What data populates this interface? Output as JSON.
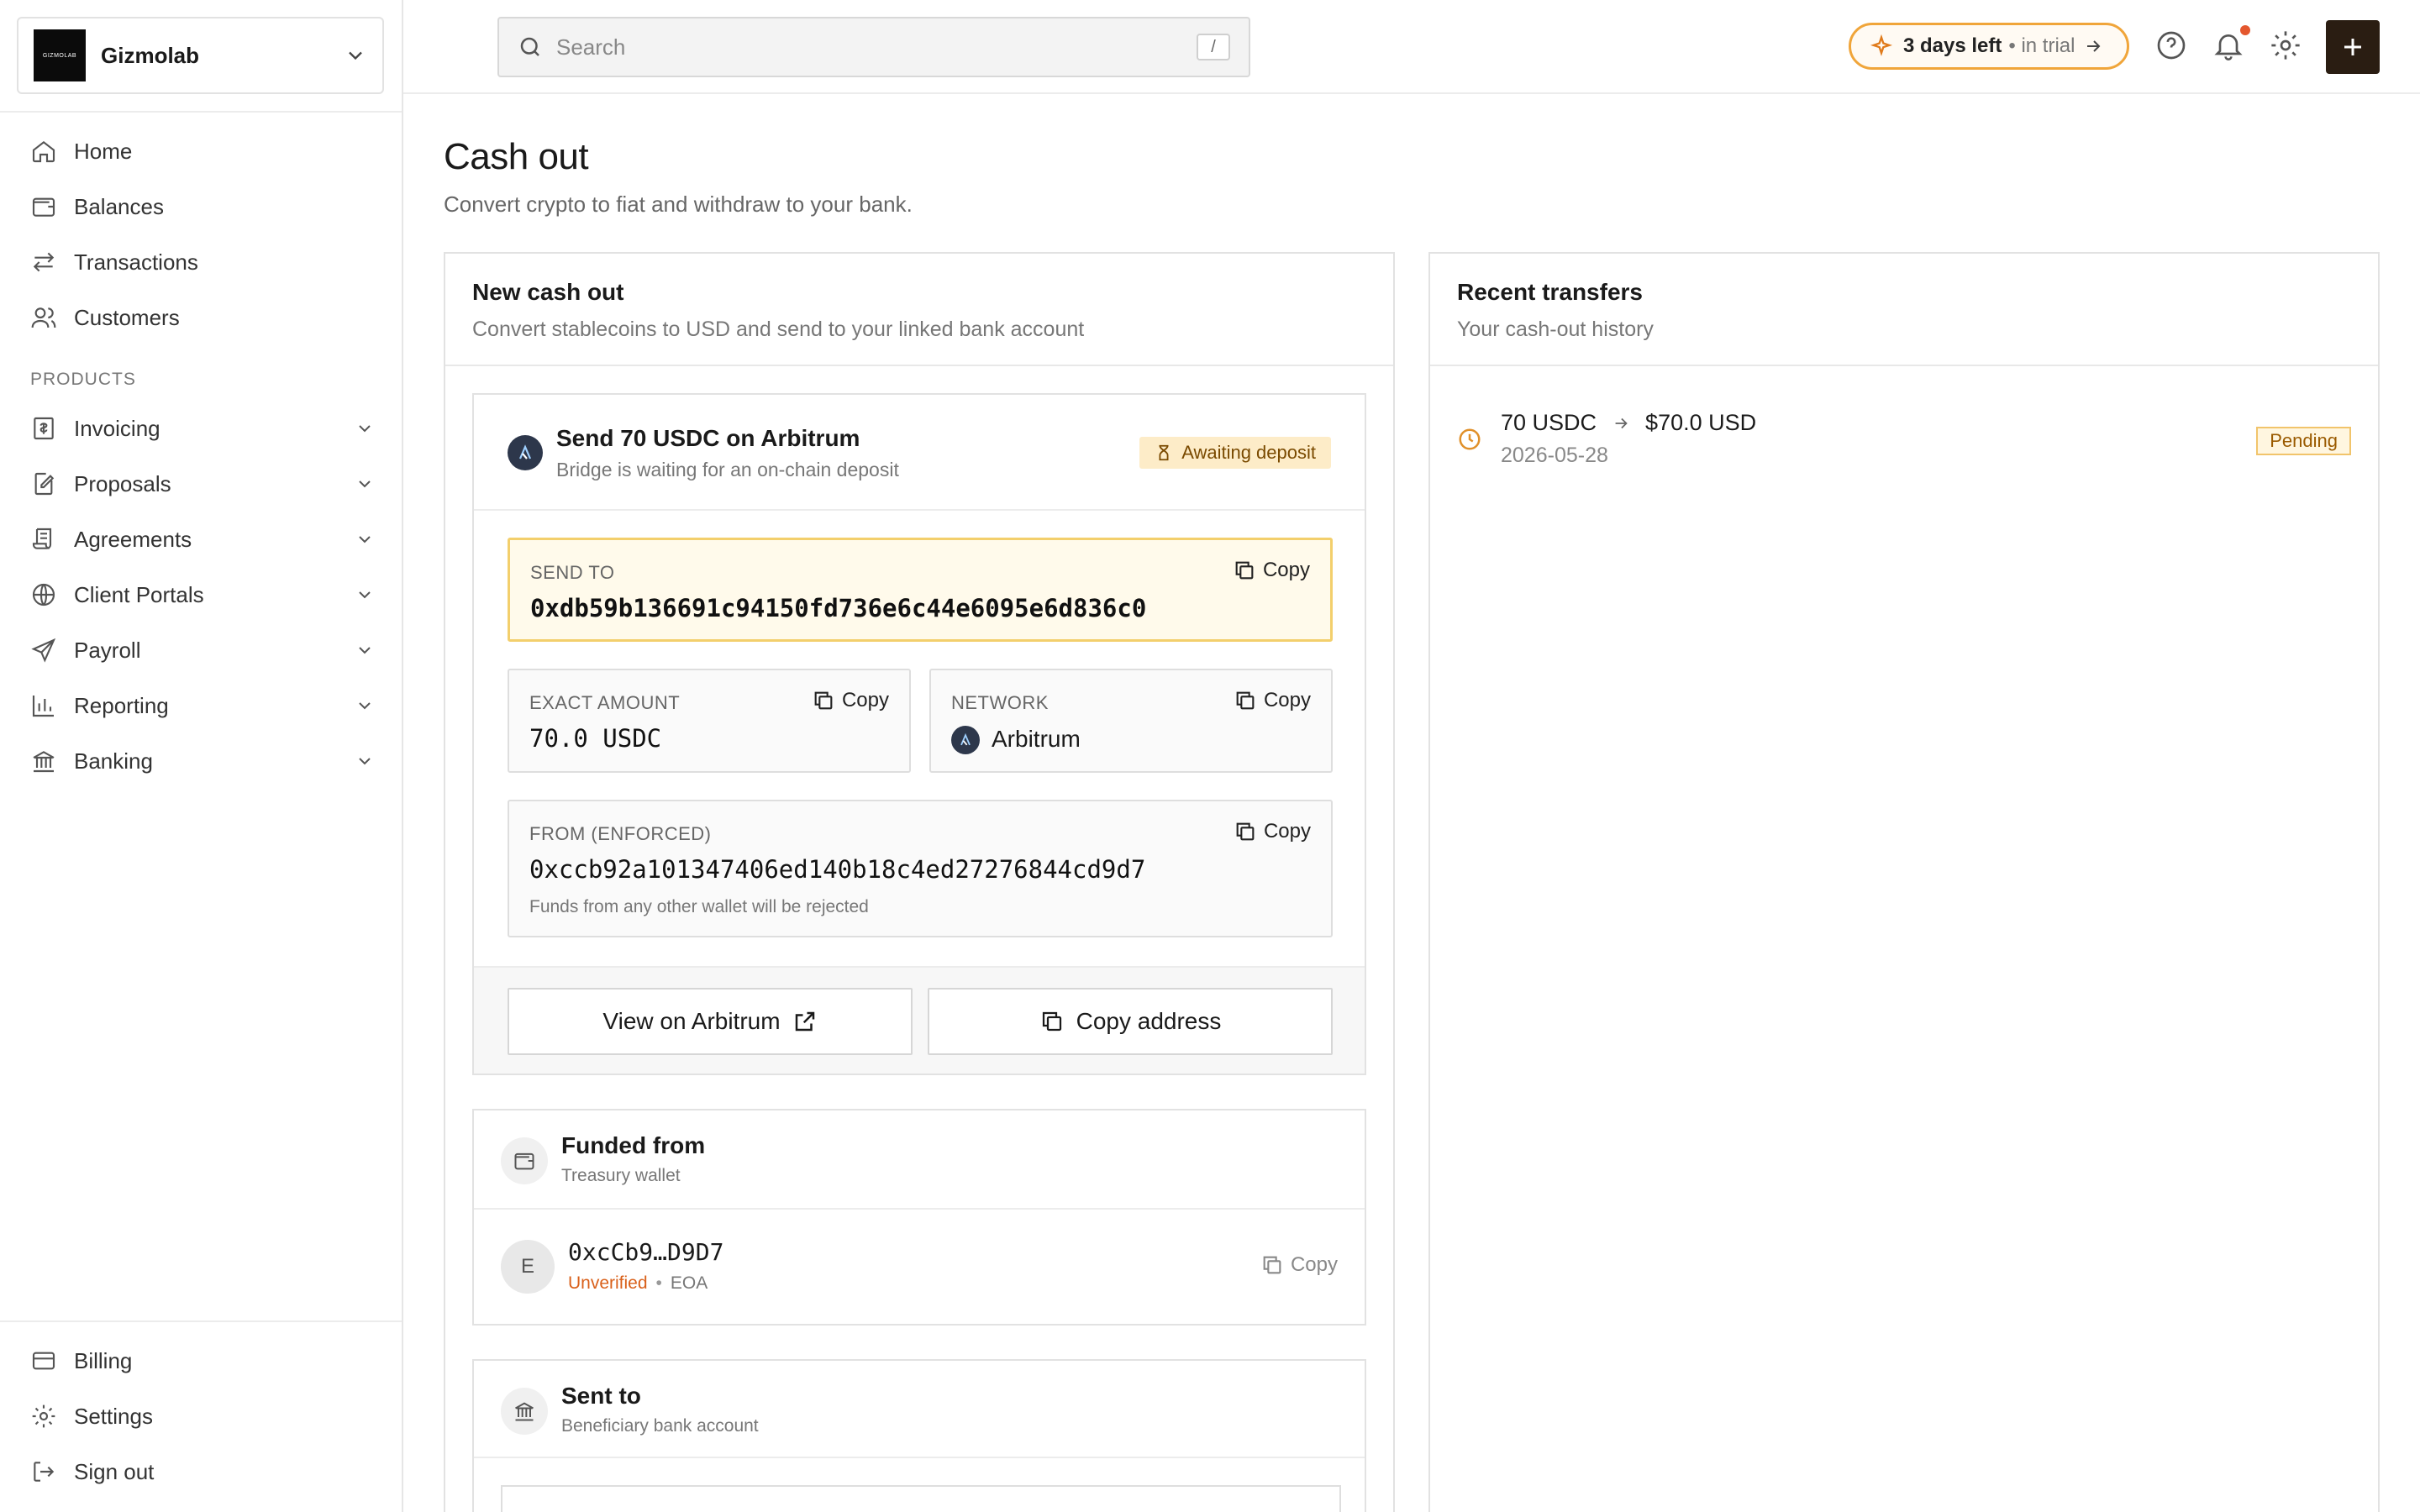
{
  "org": {
    "logo_text": "GIZMOLAB",
    "name": "Gizmolab"
  },
  "nav": {
    "primary": [
      {
        "label": "Home",
        "icon": "home-icon"
      },
      {
        "label": "Balances",
        "icon": "wallet-icon"
      },
      {
        "label": "Transactions",
        "icon": "arrows-icon"
      },
      {
        "label": "Customers",
        "icon": "users-icon"
      }
    ],
    "section_label": "PRODUCTS",
    "products": [
      {
        "label": "Invoicing",
        "icon": "invoice-icon"
      },
      {
        "label": "Proposals",
        "icon": "proposal-icon"
      },
      {
        "label": "Agreements",
        "icon": "scroll-icon"
      },
      {
        "label": "Client Portals",
        "icon": "globe-icon"
      },
      {
        "label": "Payroll",
        "icon": "send-icon"
      },
      {
        "label": "Reporting",
        "icon": "chart-icon"
      },
      {
        "label": "Banking",
        "icon": "bank-icon"
      }
    ],
    "bottom": [
      {
        "label": "Billing",
        "icon": "card-icon"
      },
      {
        "label": "Settings",
        "icon": "gear-icon"
      },
      {
        "label": "Sign out",
        "icon": "logout-icon"
      }
    ]
  },
  "topbar": {
    "search_placeholder": "Search",
    "search_shortcut": "/",
    "trial_bold": "3 days left",
    "trial_light": "• in trial"
  },
  "page": {
    "title": "Cash out",
    "subtitle": "Convert crypto to fiat and withdraw to your bank."
  },
  "new_cash_out": {
    "title": "New cash out",
    "subtitle": "Convert stablecoins to USD and send to your linked bank account",
    "deposit": {
      "title": "Send 70 USDC on Arbitrum",
      "subtitle": "Bridge is waiting for an on-chain deposit",
      "status": "Awaiting deposit",
      "send_to_label": "SEND TO",
      "send_to_value": "0xdb59b136691c94150fd736e6c44e6095e6d836c0",
      "amount_label": "EXACT AMOUNT",
      "amount_value": "70.0 USDC",
      "network_label": "NETWORK",
      "network_value": "Arbitrum",
      "from_label": "FROM (ENFORCED)",
      "from_value": "0xccb92a101347406ed140b18c4ed27276844cd9d7",
      "from_note": "Funds from any other wallet will be rejected",
      "copy_label": "Copy",
      "view_button": "View on Arbitrum",
      "copy_address_button": "Copy address"
    },
    "funded_from": {
      "title": "Funded from",
      "subtitle": "Treasury wallet",
      "avatar": "E",
      "address": "0xcCb9…D9D7",
      "status": "Unverified",
      "separator": "•",
      "type": "EOA",
      "copy_label": "Copy"
    },
    "sent_to": {
      "title": "Sent to",
      "subtitle": "Beneficiary bank account"
    }
  },
  "recent": {
    "title": "Recent transfers",
    "subtitle": "Your cash-out history",
    "items": [
      {
        "from": "70 USDC",
        "to": "$70.0 USD",
        "date": "2026-05-28",
        "status": "Pending"
      }
    ]
  },
  "colors": {
    "accent_orange": "#e07a1a",
    "pending_bg": "#fff6e0",
    "await_bg": "#fdecc8",
    "plus_button": "#2a1d12",
    "unverified": "#d9601a"
  }
}
